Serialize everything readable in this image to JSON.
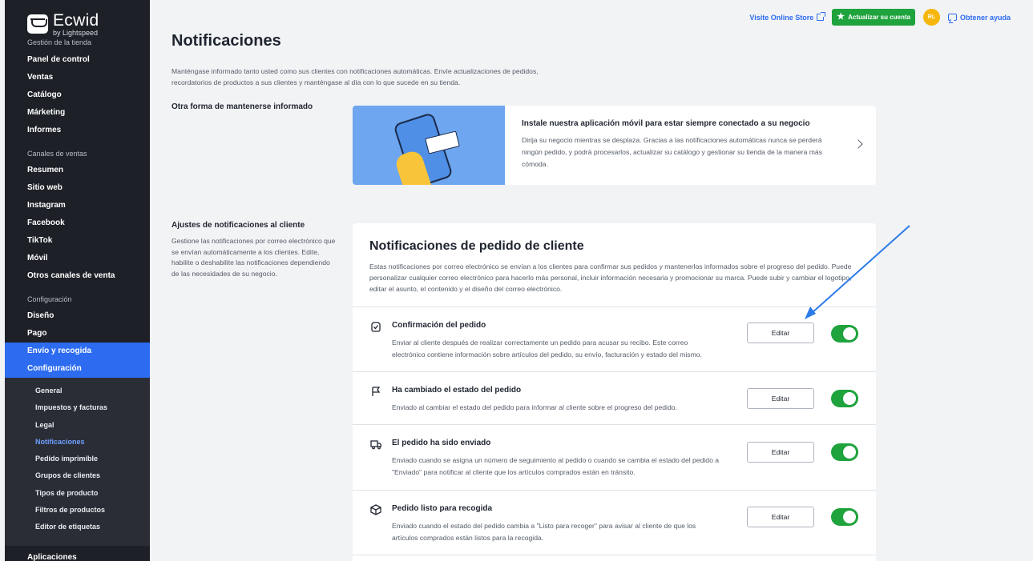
{
  "brand": {
    "name": "Ecwid",
    "sub": "by Lightspeed"
  },
  "sidebar": {
    "section_store": "Gestión de la tienda",
    "store_items": [
      {
        "label": "Panel de control"
      },
      {
        "label": "Ventas"
      },
      {
        "label": "Catálogo"
      },
      {
        "label": "Márketing"
      },
      {
        "label": "Informes"
      }
    ],
    "section_channels": "Canales de ventas",
    "channel_items": [
      {
        "label": "Resumen"
      },
      {
        "label": "Sitio web"
      },
      {
        "label": "Instagram"
      },
      {
        "label": "Facebook"
      },
      {
        "label": "TikTok"
      },
      {
        "label": "Móvil"
      },
      {
        "label": "Otros canales de venta"
      }
    ],
    "section_config": "Configuración",
    "config_items": [
      {
        "label": "Diseño"
      },
      {
        "label": "Pago"
      },
      {
        "label": "Envío y recogida"
      },
      {
        "label": "Configuración"
      }
    ],
    "sub_items": [
      {
        "label": "General"
      },
      {
        "label": "Impuestos y facturas"
      },
      {
        "label": "Legal"
      },
      {
        "label": "Notificaciones"
      },
      {
        "label": "Pedido imprimible"
      },
      {
        "label": "Grupos de clientes"
      },
      {
        "label": "Tipos de producto"
      },
      {
        "label": "Filtros de productos"
      },
      {
        "label": "Editor de etiquetas"
      }
    ],
    "apps_item": "Aplicaciones"
  },
  "topbar": {
    "visit_store": "Visite Online Store",
    "upgrade": "Actualizar su cuenta",
    "avatar": "RL",
    "help": "Obtener ayuda"
  },
  "page": {
    "title": "Notificaciones",
    "description": "Manténgase informado tanto usted como sus clientes con notificaciones automáticas. Envíe actualizaciones de pedidos, recordatorios de productos a sus clientes y manténgase al día con lo que sucede en su tienda."
  },
  "other_way": {
    "label": "Otra forma de mantenerse informado",
    "promo_title": "Instale nuestra aplicación móvil para estar siempre conectado a su negocio",
    "promo_text": "Dirija su negocio mientras se desplaza. Gracias a las notificaciones automáticas nunca se perderá ningún pedido, y podrá procesarlos, actualizar su catálogo y gestionar su tienda de la manera más cómoda."
  },
  "customer_settings": {
    "label": "Ajustes de notificaciones al cliente",
    "description": "Gestione las notificaciones por correo electrónico que se envían automáticamente a los clientes. Edite, habilite o deshabilite las notificaciones dependiendo de las necesidades de su negocio."
  },
  "order_notifications": {
    "title": "Notificaciones de pedido de cliente",
    "description": "Estas notificaciones por correo electrónico se envían a los clientes para confirmar sus pedidos y mantenerlos informados sobre el progreso del pedido. Puede personalizar cualquier correo electrónico para hacerlo más personal, incluir información necesaria y promocionar su marca. Puede subir y cambiar el logotipo, editar el asunto, el contenido y el diseño del correo electrónico.",
    "edit_label": "Editar",
    "rows": [
      {
        "title": "Confirmación del pedido",
        "desc": "Enviar al cliente después de realizar correctamente un pedido para acusar su recibo. Este correo electrónico contiene información sobre artículos del pedido, su envío, facturación y estado del mismo.",
        "icon": "shield-check-icon",
        "enabled": true
      },
      {
        "title": "Ha cambiado el estado del pedido",
        "desc": "Enviado al cambiar el estado del pedido para informar al cliente sobre el progreso del pedido.",
        "icon": "flag-icon",
        "enabled": true
      },
      {
        "title": "El pedido ha sido enviado",
        "desc": "Enviado cuando se asigna un número de seguimiento al pedido o cuando se cambia el estado del pedido a \"Enviado\" para notificar al cliente que los artículos comprados están en tránsito.",
        "icon": "truck-icon",
        "enabled": true
      },
      {
        "title": "Pedido listo para recogida",
        "desc": "Enviado cuando el estado del pedido cambia a \"Listo para recoger\" para avisar al cliente de que los artículos comprados están listos para la recogida.",
        "icon": "box-icon",
        "enabled": true
      }
    ]
  },
  "colors": {
    "accent": "#2d6cf0",
    "success": "#1fa33d",
    "sidebar": "#1d2027",
    "avatar": "#f5b60d"
  }
}
